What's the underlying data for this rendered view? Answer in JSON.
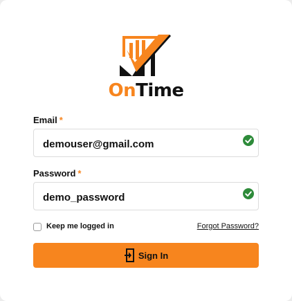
{
  "brand": {
    "name_part1": "On",
    "name_part2": "Time",
    "accent_color": "#f7851e",
    "logo_icon": "checkmark-chart-logo"
  },
  "form": {
    "email": {
      "label": "Email",
      "required_marker": "*",
      "value": "demouser@gmail.com",
      "status_icon": "valid-check-icon"
    },
    "password": {
      "label": "Password",
      "required_marker": "*",
      "value": "demo_password",
      "status_icon": "valid-check-icon"
    },
    "remember_me": {
      "label": "Keep me logged in",
      "checked": false
    },
    "forgot_password_label": "Forgot Password?",
    "submit": {
      "label": "Sign In",
      "icon": "login-icon"
    }
  },
  "colors": {
    "valid": "#2e8b3a",
    "button": "#f7851e"
  }
}
